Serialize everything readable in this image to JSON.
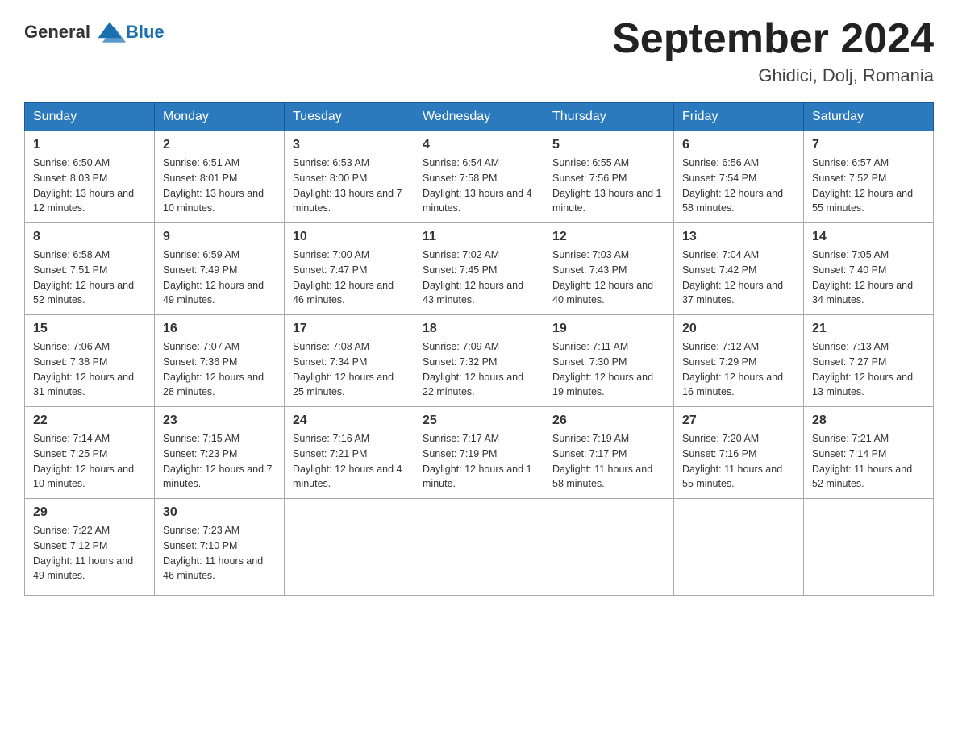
{
  "logo": {
    "text_general": "General",
    "text_blue": "Blue"
  },
  "title": "September 2024",
  "location": "Ghidici, Dolj, Romania",
  "days_of_week": [
    "Sunday",
    "Monday",
    "Tuesday",
    "Wednesday",
    "Thursday",
    "Friday",
    "Saturday"
  ],
  "weeks": [
    [
      {
        "day": "1",
        "sunrise": "6:50 AM",
        "sunset": "8:03 PM",
        "daylight": "13 hours and 12 minutes."
      },
      {
        "day": "2",
        "sunrise": "6:51 AM",
        "sunset": "8:01 PM",
        "daylight": "13 hours and 10 minutes."
      },
      {
        "day": "3",
        "sunrise": "6:53 AM",
        "sunset": "8:00 PM",
        "daylight": "13 hours and 7 minutes."
      },
      {
        "day": "4",
        "sunrise": "6:54 AM",
        "sunset": "7:58 PM",
        "daylight": "13 hours and 4 minutes."
      },
      {
        "day": "5",
        "sunrise": "6:55 AM",
        "sunset": "7:56 PM",
        "daylight": "13 hours and 1 minute."
      },
      {
        "day": "6",
        "sunrise": "6:56 AM",
        "sunset": "7:54 PM",
        "daylight": "12 hours and 58 minutes."
      },
      {
        "day": "7",
        "sunrise": "6:57 AM",
        "sunset": "7:52 PM",
        "daylight": "12 hours and 55 minutes."
      }
    ],
    [
      {
        "day": "8",
        "sunrise": "6:58 AM",
        "sunset": "7:51 PM",
        "daylight": "12 hours and 52 minutes."
      },
      {
        "day": "9",
        "sunrise": "6:59 AM",
        "sunset": "7:49 PM",
        "daylight": "12 hours and 49 minutes."
      },
      {
        "day": "10",
        "sunrise": "7:00 AM",
        "sunset": "7:47 PM",
        "daylight": "12 hours and 46 minutes."
      },
      {
        "day": "11",
        "sunrise": "7:02 AM",
        "sunset": "7:45 PM",
        "daylight": "12 hours and 43 minutes."
      },
      {
        "day": "12",
        "sunrise": "7:03 AM",
        "sunset": "7:43 PM",
        "daylight": "12 hours and 40 minutes."
      },
      {
        "day": "13",
        "sunrise": "7:04 AM",
        "sunset": "7:42 PM",
        "daylight": "12 hours and 37 minutes."
      },
      {
        "day": "14",
        "sunrise": "7:05 AM",
        "sunset": "7:40 PM",
        "daylight": "12 hours and 34 minutes."
      }
    ],
    [
      {
        "day": "15",
        "sunrise": "7:06 AM",
        "sunset": "7:38 PM",
        "daylight": "12 hours and 31 minutes."
      },
      {
        "day": "16",
        "sunrise": "7:07 AM",
        "sunset": "7:36 PM",
        "daylight": "12 hours and 28 minutes."
      },
      {
        "day": "17",
        "sunrise": "7:08 AM",
        "sunset": "7:34 PM",
        "daylight": "12 hours and 25 minutes."
      },
      {
        "day": "18",
        "sunrise": "7:09 AM",
        "sunset": "7:32 PM",
        "daylight": "12 hours and 22 minutes."
      },
      {
        "day": "19",
        "sunrise": "7:11 AM",
        "sunset": "7:30 PM",
        "daylight": "12 hours and 19 minutes."
      },
      {
        "day": "20",
        "sunrise": "7:12 AM",
        "sunset": "7:29 PM",
        "daylight": "12 hours and 16 minutes."
      },
      {
        "day": "21",
        "sunrise": "7:13 AM",
        "sunset": "7:27 PM",
        "daylight": "12 hours and 13 minutes."
      }
    ],
    [
      {
        "day": "22",
        "sunrise": "7:14 AM",
        "sunset": "7:25 PM",
        "daylight": "12 hours and 10 minutes."
      },
      {
        "day": "23",
        "sunrise": "7:15 AM",
        "sunset": "7:23 PM",
        "daylight": "12 hours and 7 minutes."
      },
      {
        "day": "24",
        "sunrise": "7:16 AM",
        "sunset": "7:21 PM",
        "daylight": "12 hours and 4 minutes."
      },
      {
        "day": "25",
        "sunrise": "7:17 AM",
        "sunset": "7:19 PM",
        "daylight": "12 hours and 1 minute."
      },
      {
        "day": "26",
        "sunrise": "7:19 AM",
        "sunset": "7:17 PM",
        "daylight": "11 hours and 58 minutes."
      },
      {
        "day": "27",
        "sunrise": "7:20 AM",
        "sunset": "7:16 PM",
        "daylight": "11 hours and 55 minutes."
      },
      {
        "day": "28",
        "sunrise": "7:21 AM",
        "sunset": "7:14 PM",
        "daylight": "11 hours and 52 minutes."
      }
    ],
    [
      {
        "day": "29",
        "sunrise": "7:22 AM",
        "sunset": "7:12 PM",
        "daylight": "11 hours and 49 minutes."
      },
      {
        "day": "30",
        "sunrise": "7:23 AM",
        "sunset": "7:10 PM",
        "daylight": "11 hours and 46 minutes."
      },
      null,
      null,
      null,
      null,
      null
    ]
  ]
}
